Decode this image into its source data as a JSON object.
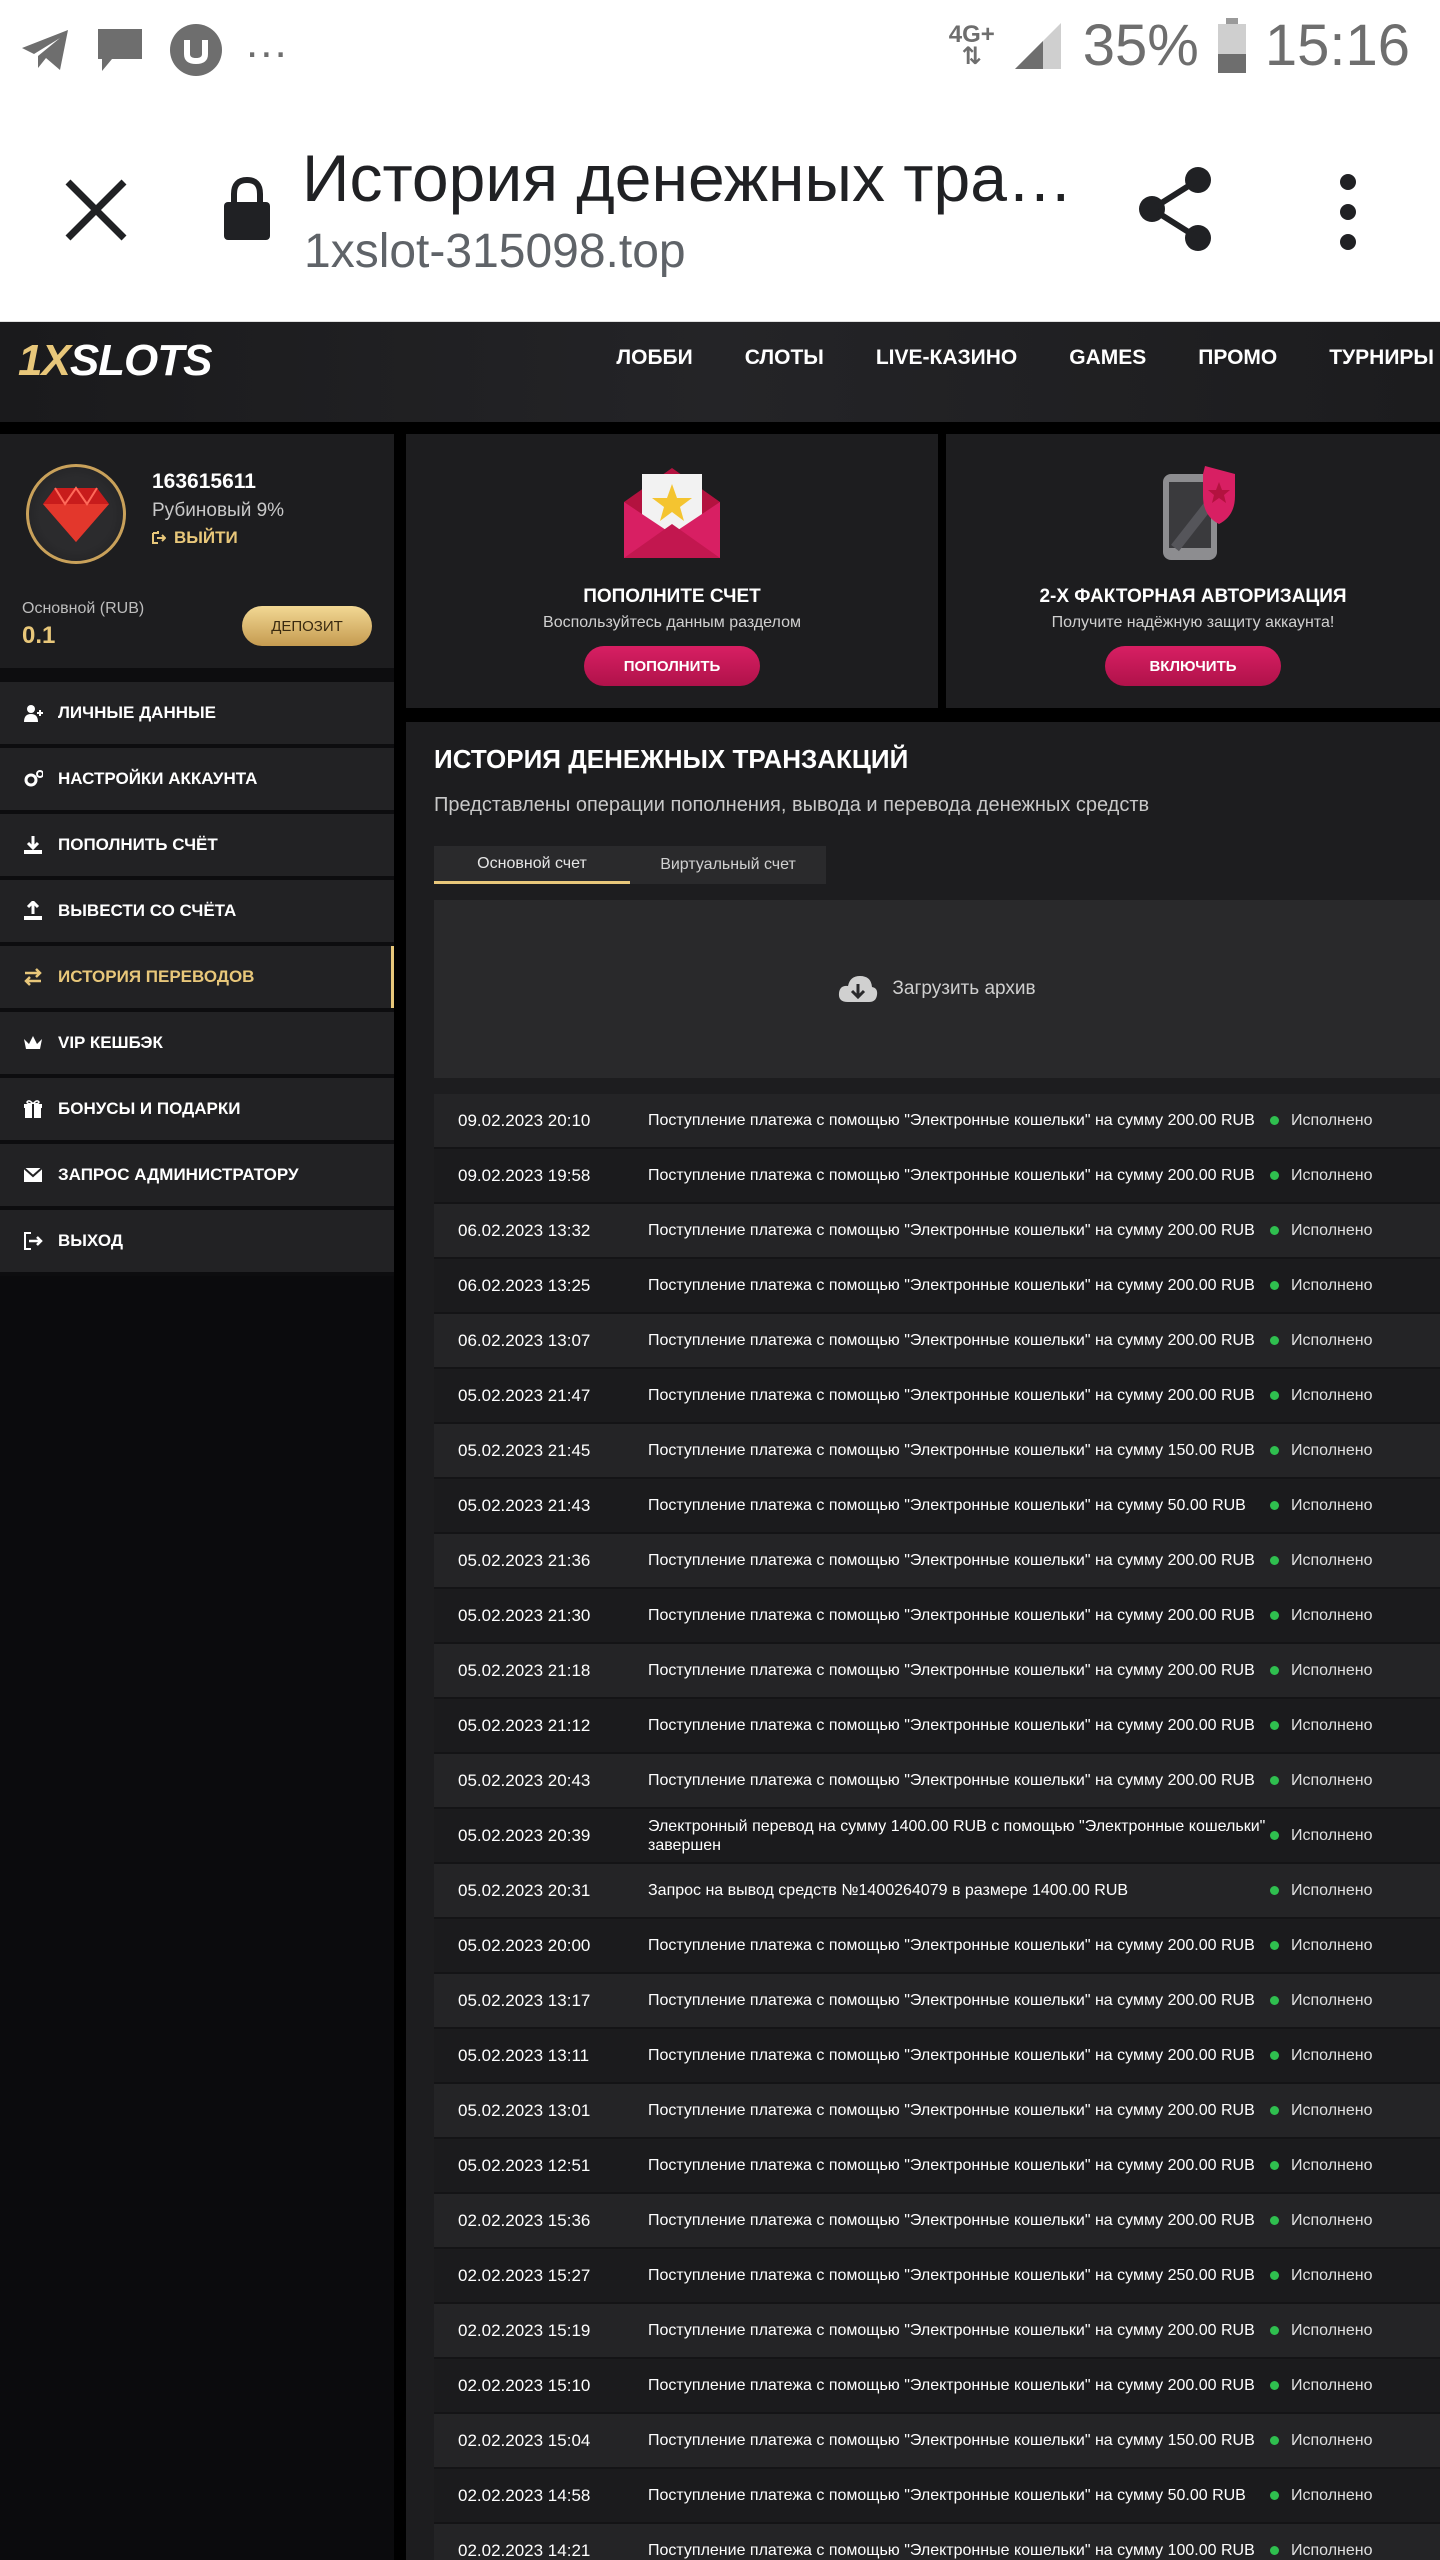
{
  "statusbar": {
    "network": "4G+",
    "battery": "35%",
    "time": "15:16",
    "overflow": "..."
  },
  "browser": {
    "title": "История денежных тра…",
    "url": "1xslot-315098.top"
  },
  "site": {
    "logo_a": "1X",
    "logo_b": "SLOTS",
    "nav": [
      "ЛОББИ",
      "СЛОТЫ",
      "LIVE-КАЗИНО",
      "GAMES",
      "ПРОМО",
      "ТУРНИРЫ"
    ]
  },
  "profile": {
    "user_id": "163615611",
    "level": "Рубиновый 9%",
    "logout": "ВЫЙТИ",
    "balance_label": "Основной (RUB)",
    "balance": "0.1",
    "deposit": "ДЕПОЗИТ"
  },
  "menu": [
    {
      "label": "ЛИЧНЫЕ ДАННЫЕ",
      "icon": "user-plus-icon"
    },
    {
      "label": "НАСТРОЙКИ АККАУНТА",
      "icon": "gears-icon"
    },
    {
      "label": "ПОПОЛНИТЬ СЧЁТ",
      "icon": "download-icon"
    },
    {
      "label": "ВЫВЕСТИ СО СЧЁТА",
      "icon": "upload-icon"
    },
    {
      "label": "ИСТОРИЯ ПЕРЕВОДОВ",
      "icon": "transfer-icon",
      "active": true
    },
    {
      "label": "VIP КЕШБЭК",
      "icon": "crown-icon"
    },
    {
      "label": "БОНУСЫ И ПОДАРКИ",
      "icon": "gift-icon"
    },
    {
      "label": "ЗАПРОС АДМИНИСТРАТОРУ",
      "icon": "envelope-icon"
    },
    {
      "label": "ВЫХОД",
      "icon": "exit-icon"
    }
  ],
  "cards": [
    {
      "title": "ПОПОЛНИТЕ СЧЕТ",
      "subtitle": "Воспользуйтесь данным разделом",
      "button": "ПОПОЛНИТЬ",
      "icon": "envelope-star-icon"
    },
    {
      "title": "2-Х ФАКТОРНАЯ АВТОРИЗАЦИЯ",
      "subtitle": "Получите надёжную защиту аккаунта!",
      "button": "ВКЛЮЧИТЬ",
      "icon": "phone-shield-icon"
    }
  ],
  "history": {
    "title": "ИСТОРИЯ ДЕНЕЖНЫХ ТРАНЗАКЦИЙ",
    "description": "Представлены операции пополнения, вывода и перевода денежных средств",
    "tabs": [
      "Основной счет",
      "Виртуальный счет"
    ],
    "archive": "Загрузить архив",
    "rows": [
      {
        "date": "09.02.2023 20:10",
        "desc": "Поступление платежа с помощью \"Электронные кошельки\" на сумму 200.00 RUB",
        "status": "Исполнено"
      },
      {
        "date": "09.02.2023 19:58",
        "desc": "Поступление платежа с помощью \"Электронные кошельки\" на сумму 200.00 RUB",
        "status": "Исполнено"
      },
      {
        "date": "06.02.2023 13:32",
        "desc": "Поступление платежа с помощью \"Электронные кошельки\" на сумму 200.00 RUB",
        "status": "Исполнено"
      },
      {
        "date": "06.02.2023 13:25",
        "desc": "Поступление платежа с помощью \"Электронные кошельки\" на сумму 200.00 RUB",
        "status": "Исполнено"
      },
      {
        "date": "06.02.2023 13:07",
        "desc": "Поступление платежа с помощью \"Электронные кошельки\" на сумму 200.00 RUB",
        "status": "Исполнено"
      },
      {
        "date": "05.02.2023 21:47",
        "desc": "Поступление платежа с помощью \"Электронные кошельки\" на сумму 200.00 RUB",
        "status": "Исполнено"
      },
      {
        "date": "05.02.2023 21:45",
        "desc": "Поступление платежа с помощью \"Электронные кошельки\" на сумму 150.00 RUB",
        "status": "Исполнено"
      },
      {
        "date": "05.02.2023 21:43",
        "desc": "Поступление платежа с помощью \"Электронные кошельки\" на сумму 50.00 RUB",
        "status": "Исполнено"
      },
      {
        "date": "05.02.2023 21:36",
        "desc": "Поступление платежа с помощью \"Электронные кошельки\" на сумму 200.00 RUB",
        "status": "Исполнено"
      },
      {
        "date": "05.02.2023 21:30",
        "desc": "Поступление платежа с помощью \"Электронные кошельки\" на сумму 200.00 RUB",
        "status": "Исполнено"
      },
      {
        "date": "05.02.2023 21:18",
        "desc": "Поступление платежа с помощью \"Электронные кошельки\" на сумму 200.00 RUB",
        "status": "Исполнено"
      },
      {
        "date": "05.02.2023 21:12",
        "desc": "Поступление платежа с помощью \"Электронные кошельки\" на сумму 200.00 RUB",
        "status": "Исполнено"
      },
      {
        "date": "05.02.2023 20:43",
        "desc": "Поступление платежа с помощью \"Электронные кошельки\" на сумму 200.00 RUB",
        "status": "Исполнено"
      },
      {
        "date": "05.02.2023 20:39",
        "desc": "Электронный перевод на сумму 1400.00 RUB с помощью \"Электронные кошельки\" завершен",
        "status": "Исполнено"
      },
      {
        "date": "05.02.2023 20:31",
        "desc": "Запрос на вывод средств №1400264079 в размере 1400.00 RUB",
        "status": "Исполнено"
      },
      {
        "date": "05.02.2023 20:00",
        "desc": "Поступление платежа с помощью \"Электронные кошельки\" на сумму 200.00 RUB",
        "status": "Исполнено"
      },
      {
        "date": "05.02.2023 13:17",
        "desc": "Поступление платежа с помощью \"Электронные кошельки\" на сумму 200.00 RUB",
        "status": "Исполнено"
      },
      {
        "date": "05.02.2023 13:11",
        "desc": "Поступление платежа с помощью \"Электронные кошельки\" на сумму 200.00 RUB",
        "status": "Исполнено"
      },
      {
        "date": "05.02.2023 13:01",
        "desc": "Поступление платежа с помощью \"Электронные кошельки\" на сумму 200.00 RUB",
        "status": "Исполнено"
      },
      {
        "date": "05.02.2023 12:51",
        "desc": "Поступление платежа с помощью \"Электронные кошельки\" на сумму 200.00 RUB",
        "status": "Исполнено"
      },
      {
        "date": "02.02.2023 15:36",
        "desc": "Поступление платежа с помощью \"Электронные кошельки\" на сумму 200.00 RUB",
        "status": "Исполнено"
      },
      {
        "date": "02.02.2023 15:27",
        "desc": "Поступление платежа с помощью \"Электронные кошельки\" на сумму 250.00 RUB",
        "status": "Исполнено"
      },
      {
        "date": "02.02.2023 15:19",
        "desc": "Поступление платежа с помощью \"Электронные кошельки\" на сумму 200.00 RUB",
        "status": "Исполнено"
      },
      {
        "date": "02.02.2023 15:10",
        "desc": "Поступление платежа с помощью \"Электронные кошельки\" на сумму 200.00 RUB",
        "status": "Исполнено"
      },
      {
        "date": "02.02.2023 15:04",
        "desc": "Поступление платежа с помощью \"Электронные кошельки\" на сумму 150.00 RUB",
        "status": "Исполнено"
      },
      {
        "date": "02.02.2023 14:58",
        "desc": "Поступление платежа с помощью \"Электронные кошельки\" на сумму 50.00 RUB",
        "status": "Исполнено"
      },
      {
        "date": "02.02.2023 14:21",
        "desc": "Поступление платежа с помощью \"Электронные кошельки\" на сумму 100.00 RUB",
        "status": "Исполнено"
      }
    ]
  },
  "colors": {
    "accent_gold": "#e8c77a",
    "button_pink": "#d81f63",
    "status_green": "#2fbf4f"
  }
}
